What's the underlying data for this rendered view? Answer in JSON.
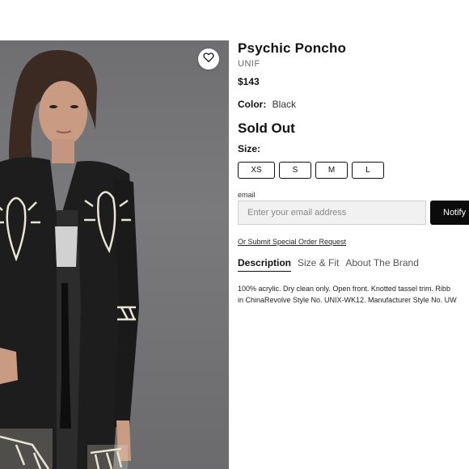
{
  "product": {
    "title": "Psychic Poncho",
    "brand": "UNIF",
    "price": "$143",
    "color_label": "Color:",
    "color_value": "Black",
    "status": "Sold Out",
    "size_label": "Size:",
    "sizes": [
      "XS",
      "S",
      "M",
      "L"
    ]
  },
  "notify": {
    "email_label": "email",
    "email_placeholder": "Enter your email address",
    "button_label": "Notify"
  },
  "special_order_link": "Or Submit Special Order Request",
  "tabs": [
    "Description",
    "Size & Fit",
    "About The Brand"
  ],
  "active_tab": "Description",
  "description": {
    "line1": "100% acrylic. Dry clean only. Open front. Knotted tassel trim. Ribb",
    "line2": "in ChinaRevolve Style No. UNIX-WK12. Manufacturer Style No. UW"
  },
  "icons": {
    "wishlist": "heart-outline-icon"
  },
  "colors": {
    "background": "#ffffff",
    "button": "#0b0b0b",
    "input_bg": "#f1f1f1",
    "photo_bg": "#727274"
  }
}
